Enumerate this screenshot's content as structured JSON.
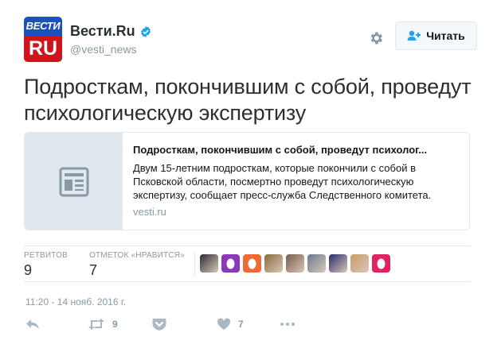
{
  "account": {
    "logo_top": "ВЕСТИ",
    "logo_bottom": "RU",
    "name": "Вести.Ru",
    "handle": "@vesti_news",
    "verified": true
  },
  "follow_button": {
    "label": "Читать"
  },
  "tweet": {
    "text": "Подросткам, покончившим с собой, проведут психологическую экспертизу"
  },
  "card": {
    "title": "Подросткам, покончившим с собой, проведут психолог...",
    "description": "Двум 15-летним подросткам, которые покончили с собой в Псковской области, посмертно проведут психологическую экспертизу, сообщает пресс-служба Следственного комитета.",
    "domain": "vesti.ru",
    "icon": "article-icon"
  },
  "stats": {
    "retweets_label": "РЕТВИТОВ",
    "retweets_value": "9",
    "likes_label": "ОТМЕТОК «НРАВИТСЯ»",
    "likes_value": "7"
  },
  "likers": [
    {
      "kind": "photo",
      "color": "#2b2b33"
    },
    {
      "kind": "egg",
      "color": "#8a3ab9"
    },
    {
      "kind": "egg",
      "color": "#f06a35"
    },
    {
      "kind": "photo",
      "color": "#8a6a3a"
    },
    {
      "kind": "photo",
      "color": "#7a5a4a"
    },
    {
      "kind": "photo",
      "color": "#6a7a8a"
    },
    {
      "kind": "photo",
      "color": "#2a2a6a"
    },
    {
      "kind": "photo",
      "color": "#c89a6a"
    },
    {
      "kind": "egg",
      "color": "#e0245e"
    }
  ],
  "timestamp": "11:20 - 14 нояб. 2016 г.",
  "actions": {
    "reply_icon": "reply-icon",
    "retweet_icon": "retweet-icon",
    "retweet_count": "9",
    "pocket_icon": "pocket-icon",
    "like_icon": "heart-icon",
    "like_count": "7",
    "more_icon": "more-icon"
  },
  "colors": {
    "brand_blue": "#1e4fbe",
    "brand_red": "#d1141c",
    "verified_blue": "#1da1f2",
    "muted": "#8899a6"
  }
}
